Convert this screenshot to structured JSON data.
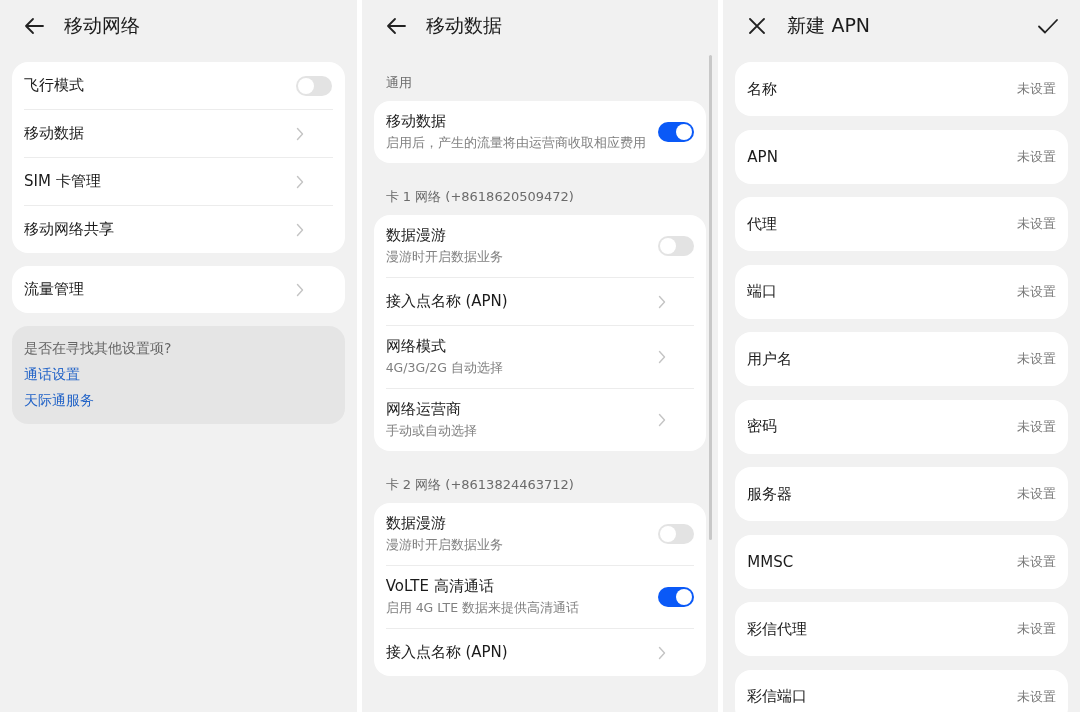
{
  "panels": [
    {
      "kind": "settings",
      "header": {
        "title": "移动网络"
      },
      "sections": [
        {
          "items": [
            {
              "kind": "switch",
              "label": "飞行模式",
              "on": false
            },
            {
              "kind": "link",
              "label": "移动数据"
            },
            {
              "kind": "link",
              "label": "SIM 卡管理"
            },
            {
              "kind": "link",
              "label": "移动网络共享"
            }
          ]
        },
        {
          "items": [
            {
              "kind": "link",
              "label": "流量管理"
            }
          ]
        }
      ],
      "suggestion": {
        "title": "是否在寻找其他设置项?",
        "links": [
          "通话设置",
          "天际通服务"
        ]
      }
    },
    {
      "kind": "settings",
      "header": {
        "title": "移动数据"
      },
      "sections": [
        {
          "heading": "通用",
          "items": [
            {
              "kind": "switch",
              "label": "移动数据",
              "description": "启用后，产生的流量将由运营商收取相应费用",
              "on": true
            }
          ]
        },
        {
          "heading": "卡 1 网络 (+8618620509472)",
          "items": [
            {
              "kind": "switch",
              "label": "数据漫游",
              "description": "漫游时开启数据业务",
              "on": false
            },
            {
              "kind": "link",
              "label": "接入点名称 (APN)"
            },
            {
              "kind": "link",
              "label": "网络模式",
              "description": "4G/3G/2G 自动选择"
            },
            {
              "kind": "link",
              "label": "网络运营商",
              "description": "手动或自动选择"
            }
          ]
        },
        {
          "heading": "卡 2 网络 (+8613824463712)",
          "items": [
            {
              "kind": "switch",
              "label": "数据漫游",
              "description": "漫游时开启数据业务",
              "on": false
            },
            {
              "kind": "switch",
              "label": "VoLTE 高清通话",
              "description": "启用 4G LTE 数据来提供高清通话",
              "on": true
            },
            {
              "kind": "link",
              "label": "接入点名称 (APN)"
            }
          ]
        }
      ]
    },
    {
      "kind": "form",
      "header": {
        "title": "新建 APN"
      },
      "fields": [
        {
          "label": "名称",
          "value": "未设置"
        },
        {
          "label": "APN",
          "value": "未设置"
        },
        {
          "label": "代理",
          "value": "未设置"
        },
        {
          "label": "端口",
          "value": "未设置"
        },
        {
          "label": "用户名",
          "value": "未设置"
        },
        {
          "label": "密码",
          "value": "未设置"
        },
        {
          "label": "服务器",
          "value": "未设置"
        },
        {
          "label": "MMSC",
          "value": "未设置"
        },
        {
          "label": "彩信代理",
          "value": "未设置"
        },
        {
          "label": "彩信端口",
          "value": "未设置"
        }
      ]
    }
  ]
}
